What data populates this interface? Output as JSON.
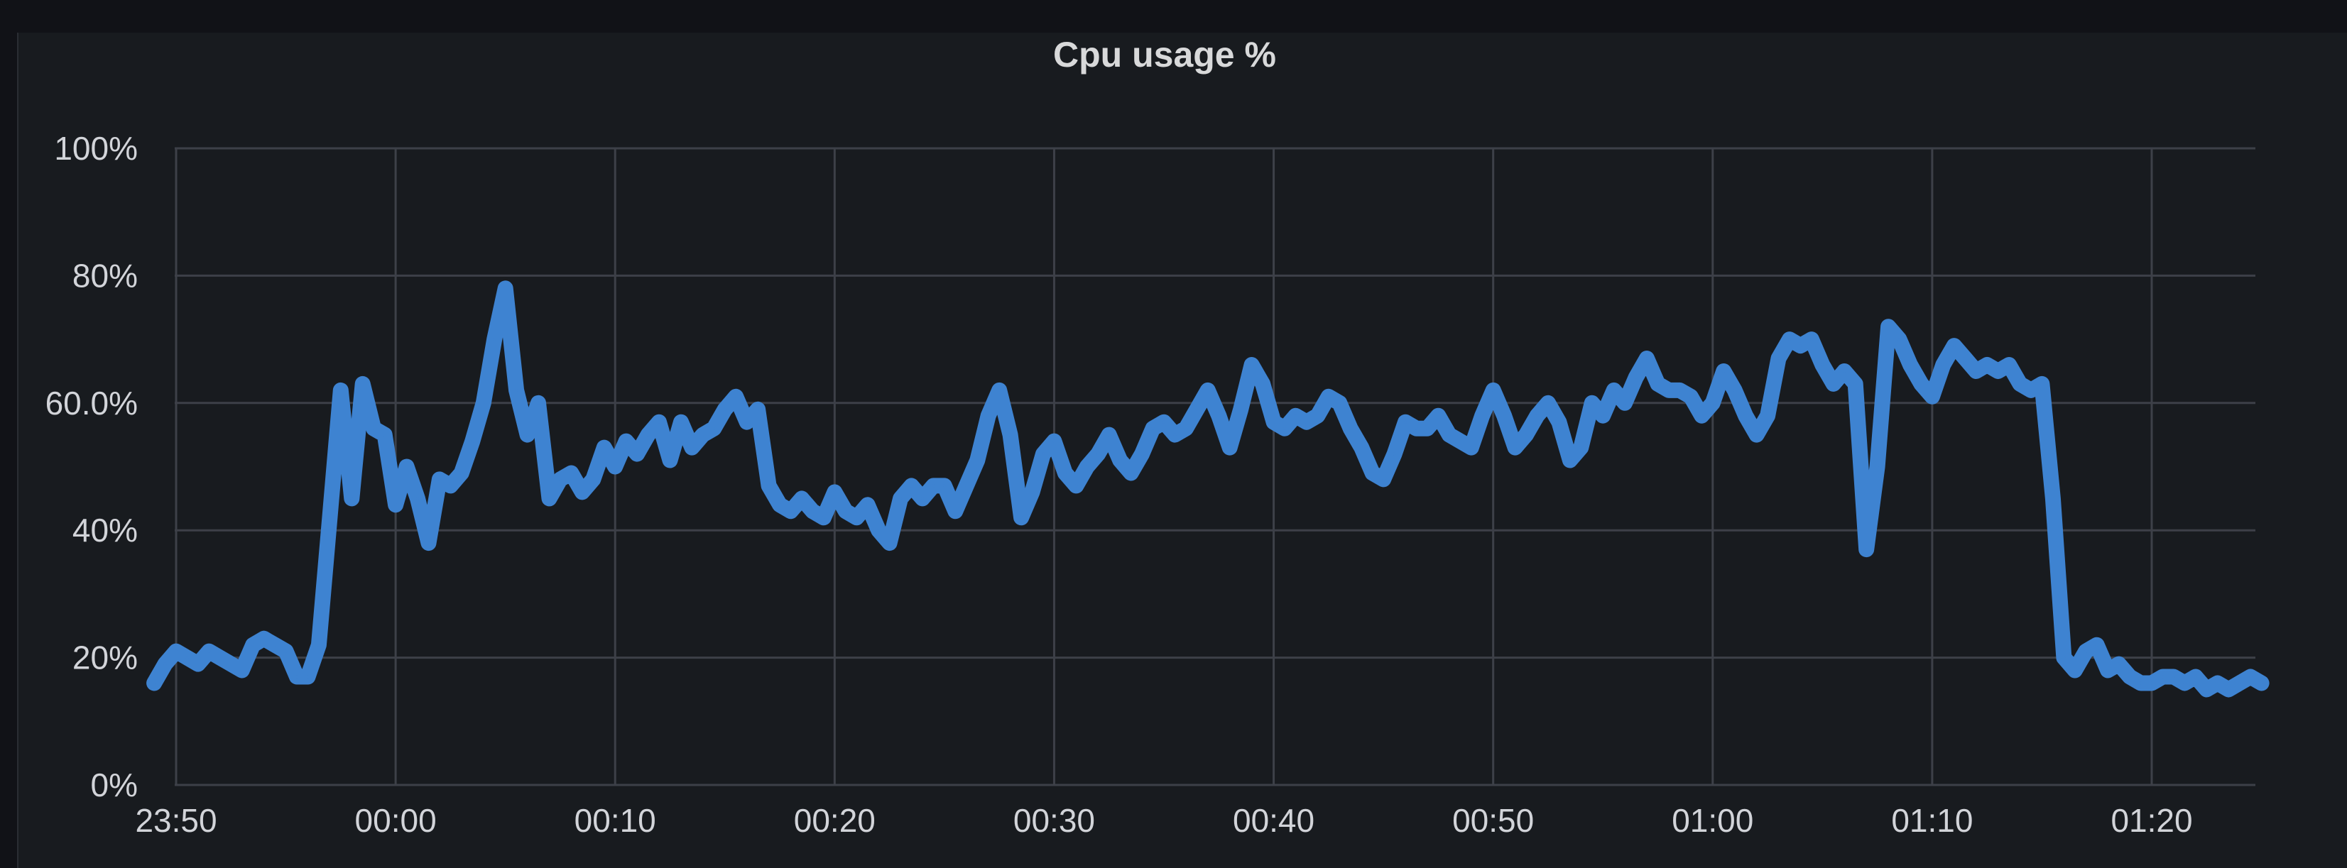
{
  "panel": {
    "title": "Cpu usage %"
  },
  "colors": {
    "background": "#111217",
    "panel": "#181b1f",
    "grid": "#3d4048",
    "axis_text": "#d2d4d9",
    "title_text": "#d8d9da",
    "series": "#3e83d1"
  },
  "chart_data": {
    "type": "line",
    "title": "Cpu usage %",
    "xlabel": "",
    "ylabel": "",
    "ylim": [
      0,
      100
    ],
    "y_ticks": [
      {
        "value": 0,
        "label": "0%"
      },
      {
        "value": 20,
        "label": "20%"
      },
      {
        "value": 40,
        "label": "40%"
      },
      {
        "value": 60,
        "label": "60.0%"
      },
      {
        "value": 80,
        "label": "80%"
      },
      {
        "value": 100,
        "label": "100%"
      }
    ],
    "x_range": [
      "23:50",
      "01:25"
    ],
    "x_ticks": [
      "23:50",
      "00:00",
      "00:10",
      "00:20",
      "00:30",
      "00:40",
      "00:50",
      "01:00",
      "01:10",
      "01:20"
    ],
    "grid": true,
    "series": [
      {
        "points": [
          [
            "23:49",
            16
          ],
          [
            "23:49.5",
            19
          ],
          [
            "23:50",
            21
          ],
          [
            "23:50.5",
            20
          ],
          [
            "23:51",
            19
          ],
          [
            "23:51.5",
            21
          ],
          [
            "23:52",
            20
          ],
          [
            "23:53",
            18
          ],
          [
            "23:53.5",
            22
          ],
          [
            "23:54",
            23
          ],
          [
            "23:54.5",
            22
          ],
          [
            "23:55",
            21
          ],
          [
            "23:55.5",
            17
          ],
          [
            "23:56",
            17
          ],
          [
            "23:56.5",
            22
          ],
          [
            "23:57",
            42
          ],
          [
            "23:57.5",
            62
          ],
          [
            "23:58",
            45
          ],
          [
            "23:58.5",
            63
          ],
          [
            "23:59",
            56
          ],
          [
            "23:59.5",
            55
          ],
          [
            "00:00",
            44
          ],
          [
            "00:00.5",
            50
          ],
          [
            "00:01",
            45
          ],
          [
            "00:01.5",
            38
          ],
          [
            "00:02",
            48
          ],
          [
            "00:02.5",
            47
          ],
          [
            "00:03",
            49
          ],
          [
            "00:03.5",
            54
          ],
          [
            "00:04",
            60
          ],
          [
            "00:04.5",
            70
          ],
          [
            "00:05",
            78
          ],
          [
            "00:05.5",
            62
          ],
          [
            "00:06",
            55
          ],
          [
            "00:06.5",
            60
          ],
          [
            "00:07",
            45
          ],
          [
            "00:07.5",
            48
          ],
          [
            "00:08",
            49
          ],
          [
            "00:08.5",
            46
          ],
          [
            "00:09",
            48
          ],
          [
            "00:09.5",
            53
          ],
          [
            "00:10",
            50
          ],
          [
            "00:10.5",
            54
          ],
          [
            "00:11",
            52
          ],
          [
            "00:11.5",
            55
          ],
          [
            "00:12",
            57
          ],
          [
            "00:12.5",
            51
          ],
          [
            "00:13",
            57
          ],
          [
            "00:13.5",
            53
          ],
          [
            "00:14",
            55
          ],
          [
            "00:14.5",
            56
          ],
          [
            "00:15",
            59
          ],
          [
            "00:15.5",
            61
          ],
          [
            "00:16",
            57
          ],
          [
            "00:16.5",
            59
          ],
          [
            "00:17",
            47
          ],
          [
            "00:17.5",
            44
          ],
          [
            "00:18",
            43
          ],
          [
            "00:18.5",
            45
          ],
          [
            "00:19",
            43
          ],
          [
            "00:19.5",
            42
          ],
          [
            "00:20",
            46
          ],
          [
            "00:20.5",
            43
          ],
          [
            "00:21",
            42
          ],
          [
            "00:21.5",
            44
          ],
          [
            "00:22",
            40
          ],
          [
            "00:22.5",
            38
          ],
          [
            "00:23",
            45
          ],
          [
            "00:23.5",
            47
          ],
          [
            "00:24",
            45
          ],
          [
            "00:24.5",
            47
          ],
          [
            "00:25",
            47
          ],
          [
            "00:25.5",
            43
          ],
          [
            "00:26",
            47
          ],
          [
            "00:26.5",
            51
          ],
          [
            "00:27",
            58
          ],
          [
            "00:27.5",
            62
          ],
          [
            "00:28",
            55
          ],
          [
            "00:28.5",
            42
          ],
          [
            "00:29",
            46
          ],
          [
            "00:29.5",
            52
          ],
          [
            "00:30",
            54
          ],
          [
            "00:30.5",
            49
          ],
          [
            "00:31",
            47
          ],
          [
            "00:31.5",
            50
          ],
          [
            "00:32",
            52
          ],
          [
            "00:32.5",
            55
          ],
          [
            "00:33",
            51
          ],
          [
            "00:33.5",
            49
          ],
          [
            "00:34",
            52
          ],
          [
            "00:34.5",
            56
          ],
          [
            "00:35",
            57
          ],
          [
            "00:35.5",
            55
          ],
          [
            "00:36",
            56
          ],
          [
            "00:36.5",
            59
          ],
          [
            "00:37",
            62
          ],
          [
            "00:37.5",
            58
          ],
          [
            "00:38",
            53
          ],
          [
            "00:38.5",
            59
          ],
          [
            "00:39",
            66
          ],
          [
            "00:39.5",
            63
          ],
          [
            "00:40",
            57
          ],
          [
            "00:40.5",
            56
          ],
          [
            "00:41",
            58
          ],
          [
            "00:41.5",
            57
          ],
          [
            "00:42",
            58
          ],
          [
            "00:42.5",
            61
          ],
          [
            "00:43",
            60
          ],
          [
            "00:43.5",
            56
          ],
          [
            "00:44",
            53
          ],
          [
            "00:44.5",
            49
          ],
          [
            "00:45",
            48
          ],
          [
            "00:45.5",
            52
          ],
          [
            "00:46",
            57
          ],
          [
            "00:46.5",
            56
          ],
          [
            "00:47",
            56
          ],
          [
            "00:47.5",
            58
          ],
          [
            "00:48",
            55
          ],
          [
            "00:48.5",
            54
          ],
          [
            "00:49",
            53
          ],
          [
            "00:49.5",
            58
          ],
          [
            "00:50",
            62
          ],
          [
            "00:50.5",
            58
          ],
          [
            "00:51",
            53
          ],
          [
            "00:51.5",
            55
          ],
          [
            "00:52",
            58
          ],
          [
            "00:52.5",
            60
          ],
          [
            "00:53",
            57
          ],
          [
            "00:53.5",
            51
          ],
          [
            "00:54",
            53
          ],
          [
            "00:54.5",
            60
          ],
          [
            "00:55",
            58
          ],
          [
            "00:55.5",
            62
          ],
          [
            "00:56",
            60
          ],
          [
            "00:56.5",
            64
          ],
          [
            "00:57",
            67
          ],
          [
            "00:57.5",
            63
          ],
          [
            "00:58",
            62
          ],
          [
            "00:58.5",
            62
          ],
          [
            "00:59",
            61
          ],
          [
            "00:59.5",
            58
          ],
          [
            "01:00",
            60
          ],
          [
            "01:00.5",
            65
          ],
          [
            "01:01",
            62
          ],
          [
            "01:01.5",
            58
          ],
          [
            "01:02",
            55
          ],
          [
            "01:02.5",
            58
          ],
          [
            "01:03",
            67
          ],
          [
            "01:03.5",
            70
          ],
          [
            "01:04",
            69
          ],
          [
            "01:04.5",
            70
          ],
          [
            "01:05",
            66
          ],
          [
            "01:05.5",
            63
          ],
          [
            "01:06",
            65
          ],
          [
            "01:06.5",
            63
          ],
          [
            "01:07",
            37
          ],
          [
            "01:07.5",
            50
          ],
          [
            "01:08",
            72
          ],
          [
            "01:08.5",
            70
          ],
          [
            "01:09",
            66
          ],
          [
            "01:09.5",
            63
          ],
          [
            "01:10",
            61
          ],
          [
            "01:10.5",
            66
          ],
          [
            "01:11",
            69
          ],
          [
            "01:11.5",
            67
          ],
          [
            "01:12",
            65
          ],
          [
            "01:12.5",
            66
          ],
          [
            "01:13",
            65
          ],
          [
            "01:13.5",
            66
          ],
          [
            "01:14",
            63
          ],
          [
            "01:14.5",
            62
          ],
          [
            "01:15",
            63
          ],
          [
            "01:15.5",
            45
          ],
          [
            "01:16",
            20
          ],
          [
            "01:16.5",
            18
          ],
          [
            "01:17",
            21
          ],
          [
            "01:17.5",
            22
          ],
          [
            "01:18",
            18
          ],
          [
            "01:18.5",
            19
          ],
          [
            "01:19",
            17
          ],
          [
            "01:19.5",
            16
          ],
          [
            "01:20",
            16
          ],
          [
            "01:20.5",
            17
          ],
          [
            "01:21",
            17
          ],
          [
            "01:21.5",
            16
          ],
          [
            "01:22",
            17
          ],
          [
            "01:22.5",
            15
          ],
          [
            "01:23",
            16
          ],
          [
            "01:23.5",
            15
          ],
          [
            "01:24",
            16
          ],
          [
            "01:24.5",
            17
          ],
          [
            "01:25",
            16
          ]
        ]
      }
    ]
  }
}
